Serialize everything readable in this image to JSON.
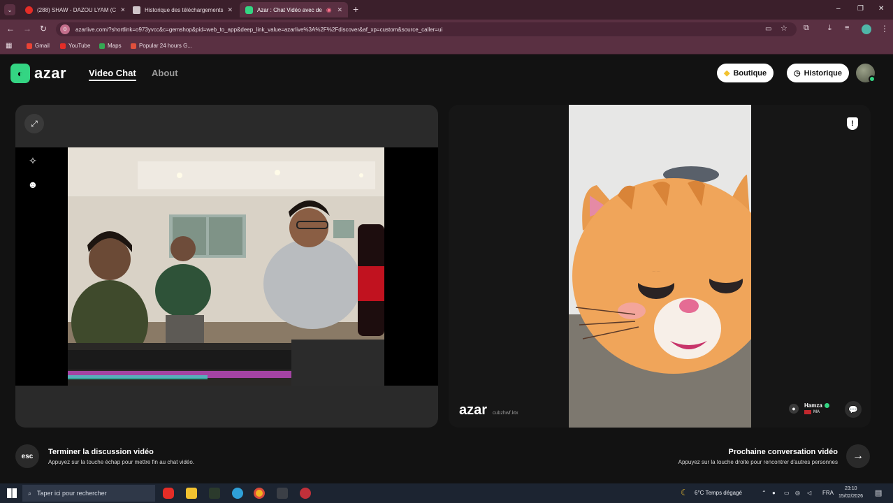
{
  "browser": {
    "tabs": [
      {
        "title": "(288) SHAW - DAZOU LYAM (C",
        "favicon_color": "#e52d27",
        "active": false
      },
      {
        "title": "Historique des téléchargements",
        "favicon_color": "#cfc5c9",
        "active": false
      },
      {
        "title": "Azar : Chat Vidéo avec de",
        "favicon_color": "#34d583",
        "active": true
      }
    ],
    "new_tab": "+",
    "url": "azarlive.com/?shortlink=o973yvcc&c=gemshop&pid=web_to_app&deep_link_value=azarlive%3A%2F%2Fdiscover&af_xp=custom&source_caller=ui",
    "bookmarks": [
      "Gmail",
      "YouTube",
      "Maps",
      "Popular 24 hours G..."
    ],
    "window_controls": [
      "–",
      "❐",
      "✕"
    ]
  },
  "app": {
    "logo_text": "azar",
    "nav": {
      "video_chat": "Video Chat",
      "about": "About"
    },
    "buttons": {
      "boutique": "Boutique",
      "historique": "Historique"
    },
    "watermark": "azar",
    "watermark_sub": "cubzhwf.ktx",
    "peer": {
      "name": "Hamza",
      "country": "MA"
    },
    "footer": {
      "esc_key": "esc",
      "end_title": "Terminer la discussion vidéo",
      "end_sub": "Appuyez sur la touche échap pour mettre fin au chat vidéo.",
      "next_title": "Prochaine conversation vidéo",
      "next_sub": "Appuyez sur la touche droite pour rencontrer d'autres personnes"
    },
    "colors": {
      "accent": "#34d583",
      "background": "#121212"
    }
  },
  "taskbar": {
    "search_placeholder": "Taper ici pour rechercher",
    "weather": "6°C  Temps dégagé",
    "language": "FRA",
    "time": "23:10",
    "date": "15/02/2026"
  }
}
